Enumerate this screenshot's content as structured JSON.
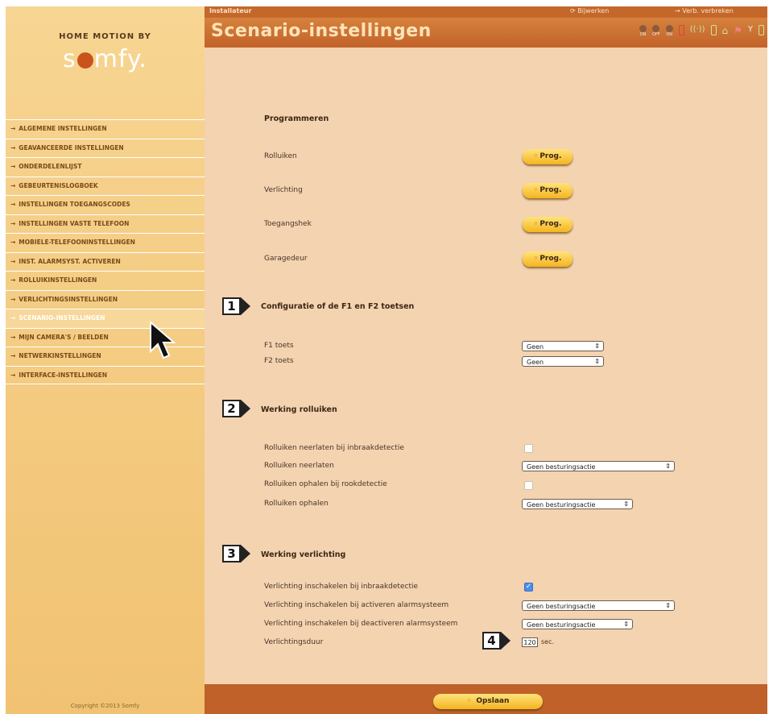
{
  "brand": {
    "tagline": "HOME MOTION BY",
    "logo_pre": "s",
    "logo_post": "mfy",
    "logo_dot": "."
  },
  "topbar": {
    "left_title": "Installateur",
    "refresh": "Bijwerken",
    "disconnect": "Verb. verbreken"
  },
  "header": {
    "title": "Scenario-instellingen"
  },
  "status_icons": [
    {
      "name": "alarm-on-icon",
      "label": "ON"
    },
    {
      "name": "alarm-off-icon",
      "label": "OFF"
    },
    {
      "name": "alarm-partial-on-icon",
      "label": "ON"
    }
  ],
  "sidebar": {
    "items": [
      {
        "label": "ALGEMENE INSTELLINGEN"
      },
      {
        "label": "GEAVANCEERDE INSTELLINGEN"
      },
      {
        "label": "ONDERDELENLIJST"
      },
      {
        "label": "GEBEURTENISLOGBOEK"
      },
      {
        "label": "INSTELLINGEN TOEGANGSCODES"
      },
      {
        "label": "INSTELLINGEN VASTE TELEFOON"
      },
      {
        "label": "MOBIELE-TELEFOONINSTELLINGEN"
      },
      {
        "label": "INST. ALARMSYST. ACTIVEREN"
      },
      {
        "label": "ROLLUIKINSTELLINGEN"
      },
      {
        "label": "VERLICHTINGSINSTELLINGEN"
      },
      {
        "label": "SCENARIO-INSTELLINGEN"
      },
      {
        "label": "MIJN CAMERA'S / BEELDEN"
      },
      {
        "label": "NETWERKINSTELLINGEN"
      },
      {
        "label": "INTERFACE-INSTELLINGEN"
      }
    ],
    "copyright": "Copyright ©2013 Somfy",
    "arrow": "→"
  },
  "programmeren": {
    "title": "Programmeren",
    "button_label": "Prog.",
    "rows": [
      {
        "label": "Rolluiken"
      },
      {
        "label": "Verlichting"
      },
      {
        "label": "Toegangshek"
      },
      {
        "label": "Garagedeur"
      }
    ]
  },
  "config_f": {
    "callout": "1",
    "title": "Configuratie of de F1 en F2 toetsen",
    "rows": [
      {
        "label": "F1 toets",
        "value": "Geen"
      },
      {
        "label": "F2 toets",
        "value": "Geen"
      }
    ]
  },
  "rolluiken": {
    "callout": "2",
    "title": "Werking rolluiken",
    "rows": [
      {
        "label": "Rolluiken neerlaten bij inbraakdetectie",
        "checked": false
      },
      {
        "label": "Rolluiken neerlaten",
        "value": "Geen besturingsactie"
      },
      {
        "label": "Rolluiken ophalen bij rookdetectie",
        "checked": false
      },
      {
        "label": "Rolluiken ophalen",
        "value": "Geen besturingsactie"
      }
    ]
  },
  "verlichting": {
    "callout": "3",
    "title": "Werking verlichting",
    "rows": [
      {
        "label": "Verlichting inschakelen bij inbraakdetectie",
        "checked": true
      },
      {
        "label": "Verlichting inschakelen bij activeren alarmsysteem",
        "value": "Geen besturingsactie"
      },
      {
        "label": "Verlichting inschakelen bij deactiveren alarmsysteem",
        "value": "Geen besturingsactie"
      },
      {
        "label": "Verlichtingsduur",
        "value": "120",
        "unit": "sec."
      }
    ],
    "callout4": "4"
  },
  "footer": {
    "save_label": "Opslaan"
  },
  "colors": {
    "accent": "#c4672b",
    "sidebar": "#f4c98a",
    "main_bg": "#f3d3b0",
    "button": "#f5b420"
  }
}
